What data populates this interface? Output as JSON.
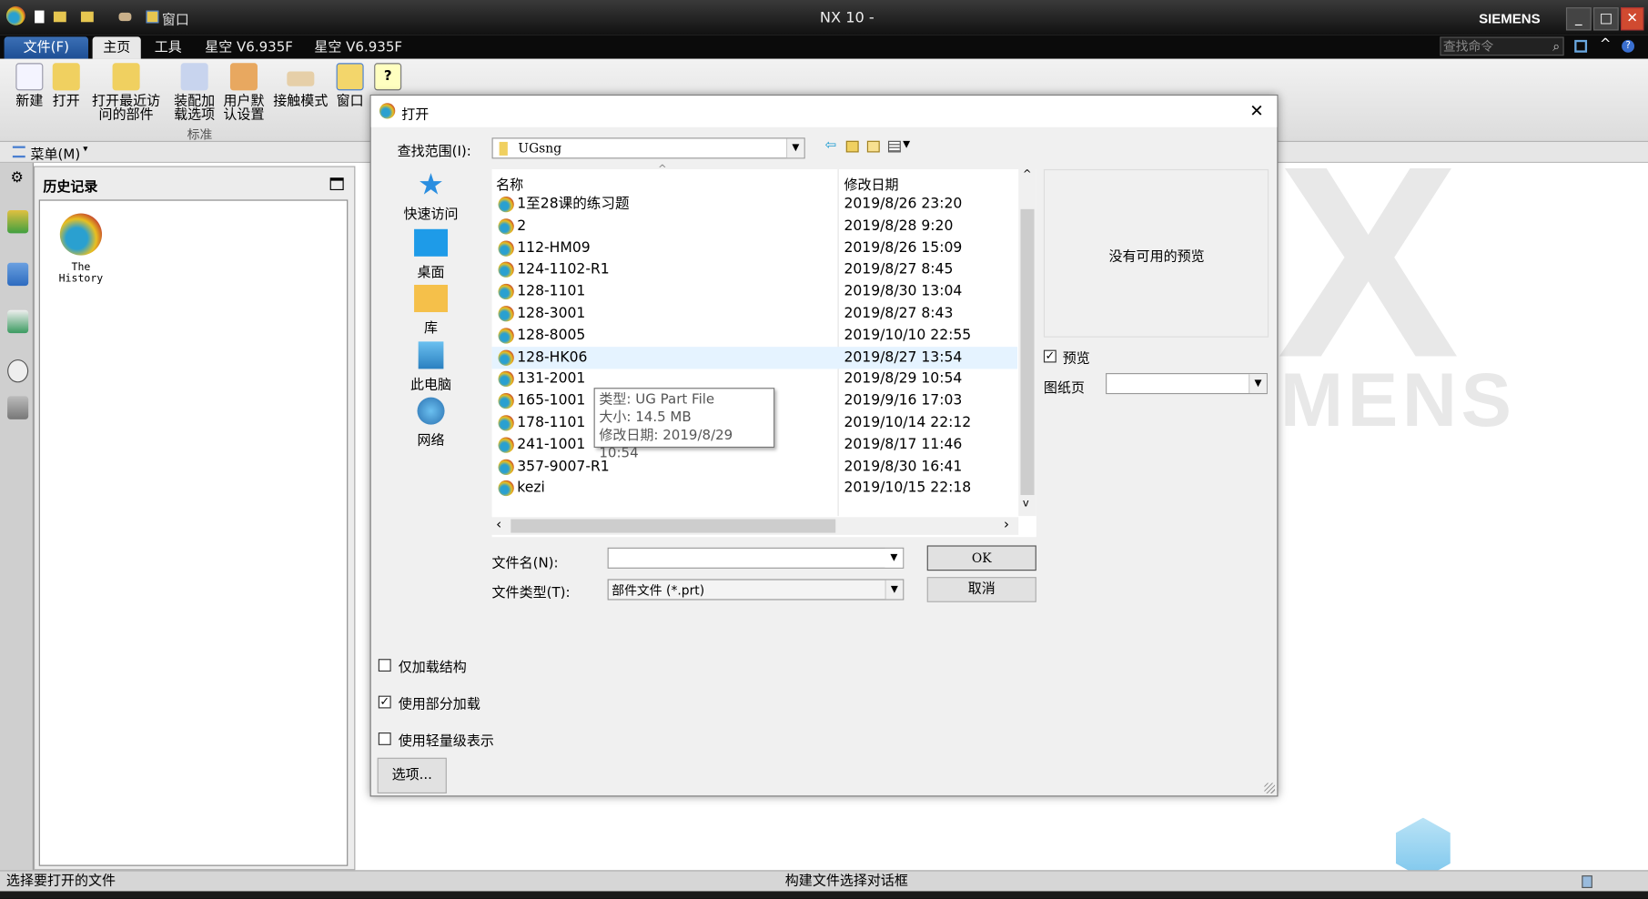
{
  "window": {
    "title": "NX 10 -",
    "brand": "SIEMENS",
    "qat_window": "窗口",
    "search_placeholder": "查找命令"
  },
  "tabs": [
    {
      "label": "文件(F)"
    },
    {
      "label": "主页"
    },
    {
      "label": "工具"
    },
    {
      "label": "星空 V6.935F"
    },
    {
      "label": "星空 V6.935F"
    }
  ],
  "ribbon": {
    "buttons": [
      {
        "label": "新建"
      },
      {
        "label": "打开"
      },
      {
        "label": "打开最近访\n问的部件"
      },
      {
        "label": "装配加\n载选项"
      },
      {
        "label": "用户默\n认设置"
      },
      {
        "label": "接触模式"
      },
      {
        "label": "窗口"
      }
    ],
    "group_label": "标准"
  },
  "menubar": {
    "menu": "菜单(M)"
  },
  "history": {
    "title": "历史记录",
    "item": "The\nHistory"
  },
  "status": {
    "left": "选择要打开的文件",
    "center": "构建文件选择对话框"
  },
  "watermark": {
    "text": "SIEMENS"
  },
  "dialog": {
    "title": "打开",
    "look_in_label": "查找范围(I):",
    "look_in_value": "UGsng",
    "places": [
      {
        "label": "快速访问"
      },
      {
        "label": "桌面"
      },
      {
        "label": "库"
      },
      {
        "label": "此电脑"
      },
      {
        "label": "网络"
      }
    ],
    "columns": {
      "name": "名称",
      "date": "修改日期"
    },
    "files": [
      {
        "name": "1至28课的练习题",
        "date": "2019/8/26 23:20"
      },
      {
        "name": "2",
        "date": "2019/8/28 9:20"
      },
      {
        "name": "112-HM09",
        "date": "2019/8/26 15:09"
      },
      {
        "name": "124-1102-R1",
        "date": "2019/8/27 8:45"
      },
      {
        "name": "128-1101",
        "date": "2019/8/30 13:04"
      },
      {
        "name": "128-3001",
        "date": "2019/8/27 8:43"
      },
      {
        "name": "128-8005",
        "date": "2019/10/10 22:55"
      },
      {
        "name": "128-HK06",
        "date": "2019/8/27 13:54",
        "selected": true
      },
      {
        "name": "131-2001",
        "date": "2019/8/29 10:54"
      },
      {
        "name": "165-1001",
        "date": "2019/9/16 17:03"
      },
      {
        "name": "178-1101",
        "date": "2019/10/14 22:12"
      },
      {
        "name": "241-1001",
        "date": "2019/8/17 11:46"
      },
      {
        "name": "357-9007-R1",
        "date": "2019/8/30 16:41"
      },
      {
        "name": "kezi",
        "date": "2019/10/15 22:18"
      }
    ],
    "tooltip": {
      "type": "类型: UG Part File",
      "size": "大小: 14.5 MB",
      "modified": "修改日期: 2019/8/29 10:54"
    },
    "preview_text": "没有可用的预览",
    "preview_checkbox": {
      "label": "预览",
      "checked": true
    },
    "sheet_label": "图纸页",
    "sheet_value": "",
    "filename_label": "文件名(N):",
    "filename_value": "",
    "filetype_label": "文件类型(T):",
    "filetype_value": "部件文件 (*.prt)",
    "ok": "OK",
    "cancel": "取消",
    "options": [
      {
        "label": "仅加载结构",
        "checked": false
      },
      {
        "label": "使用部分加载",
        "checked": true
      },
      {
        "label": "使用轻量级表示",
        "checked": false
      }
    ],
    "options_button": "选项..."
  }
}
